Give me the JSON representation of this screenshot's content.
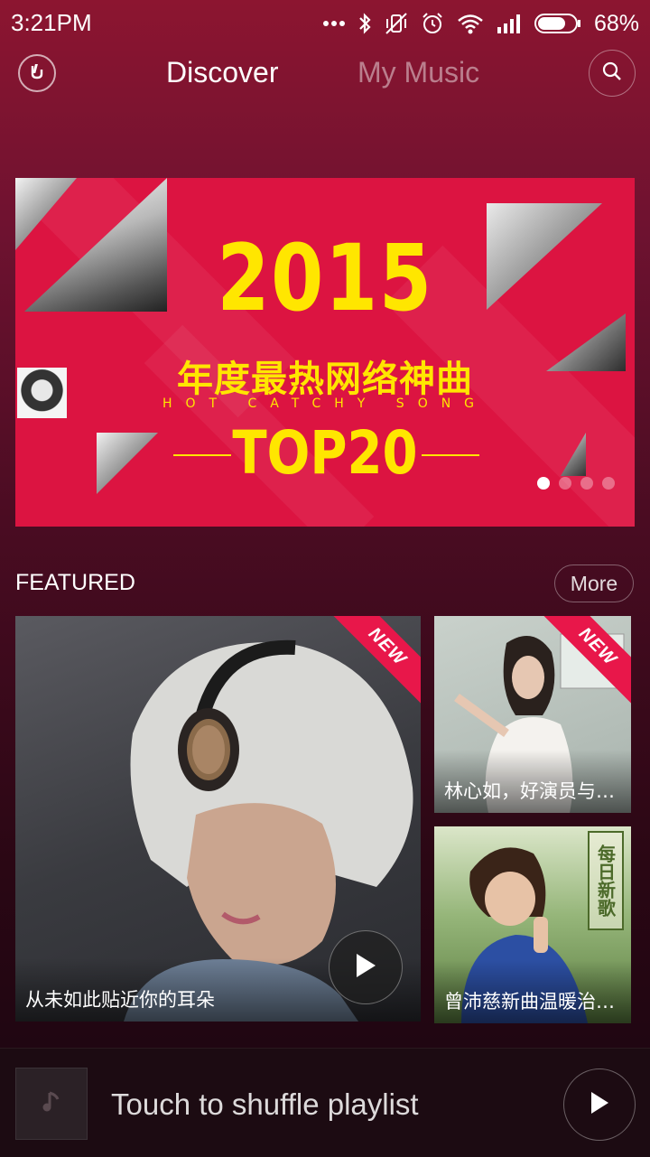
{
  "status_bar": {
    "time": "3:21PM",
    "battery": "68%",
    "icons": [
      "more-dots-icon",
      "bluetooth-icon",
      "vibrate-off-icon",
      "alarm-icon",
      "wifi-icon",
      "signal-icon",
      "battery-icon"
    ]
  },
  "nav": {
    "tabs": [
      {
        "label": "Discover",
        "active": true
      },
      {
        "label": "My Music",
        "active": false
      }
    ]
  },
  "banner": {
    "year": "2015",
    "title_cn": "年度最热网络神曲",
    "subtitle": "HOT CATCHY SONG",
    "rank": "TOP20",
    "page_count": 4,
    "active_page": 0,
    "accent_color": "#dc1441",
    "text_color": "#ffe600"
  },
  "featured": {
    "heading": "FEATURED",
    "more_label": "More",
    "items": [
      {
        "caption": "从未如此贴近你的耳朵",
        "badge": "",
        "has_play": true
      },
      {
        "caption": "林心如，好演员与…",
        "badge": "NEW"
      },
      {
        "caption": "曾沛慈新曲温暖治…",
        "badge": ""
      }
    ],
    "main_badge": "NEW",
    "card_b_sign": "每日新歌"
  },
  "player": {
    "text": "Touch to shuffle playlist"
  }
}
